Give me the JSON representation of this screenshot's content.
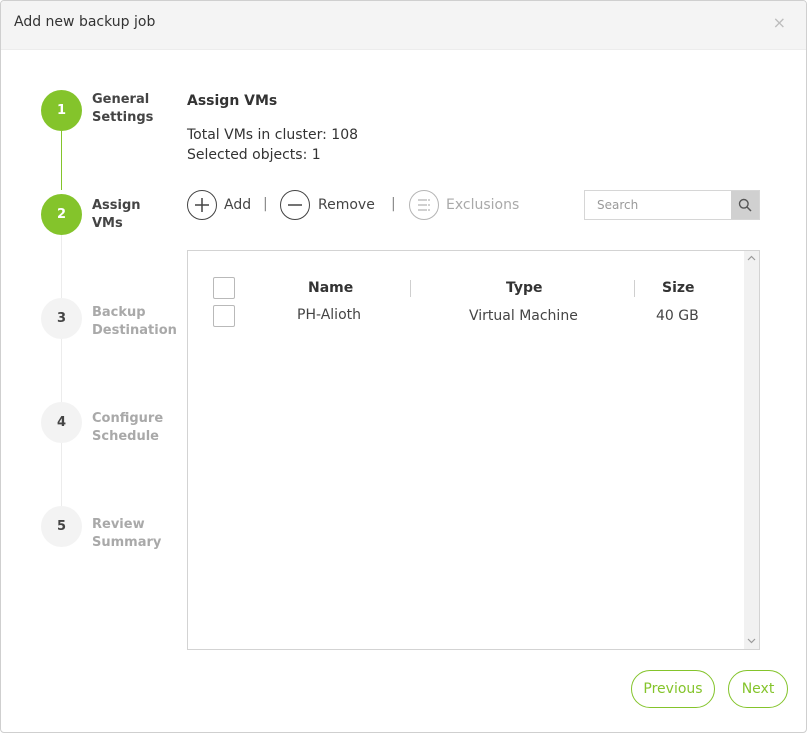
{
  "dialog": {
    "title": "Add new backup job",
    "close_label": "×"
  },
  "colors": {
    "accent": "#84c42b",
    "inactive_step_bg": "#f3f3f3",
    "inactive_text": "#a9a9a9"
  },
  "steps": [
    {
      "number": "1",
      "line1": "General",
      "line2": "Settings",
      "state": "completed"
    },
    {
      "number": "2",
      "line1": "Assign",
      "line2": "VMs",
      "state": "active"
    },
    {
      "number": "3",
      "line1": "Backup",
      "line2": "Destination",
      "state": "inactive"
    },
    {
      "number": "4",
      "line1": "Configure",
      "line2": "Schedule",
      "state": "inactive"
    },
    {
      "number": "5",
      "line1": "Review",
      "line2": "Summary",
      "state": "inactive"
    }
  ],
  "main": {
    "title": "Assign VMs",
    "total_vms": "Total VMs in cluster: 108",
    "selected_objects": "Selected objects: 1"
  },
  "toolbar": {
    "add_label": "Add",
    "remove_label": "Remove",
    "exclusions_label": "Exclusions",
    "separator": "|",
    "search_placeholder": "Search",
    "search_value": ""
  },
  "table": {
    "columns": [
      "Name",
      "Type",
      "Size"
    ],
    "rows": [
      {
        "name": "PH-Alioth",
        "type": "Virtual Machine",
        "size": "40 GB",
        "checked": false
      }
    ]
  },
  "footer": {
    "previous_label": "Previous",
    "next_label": "Next"
  }
}
